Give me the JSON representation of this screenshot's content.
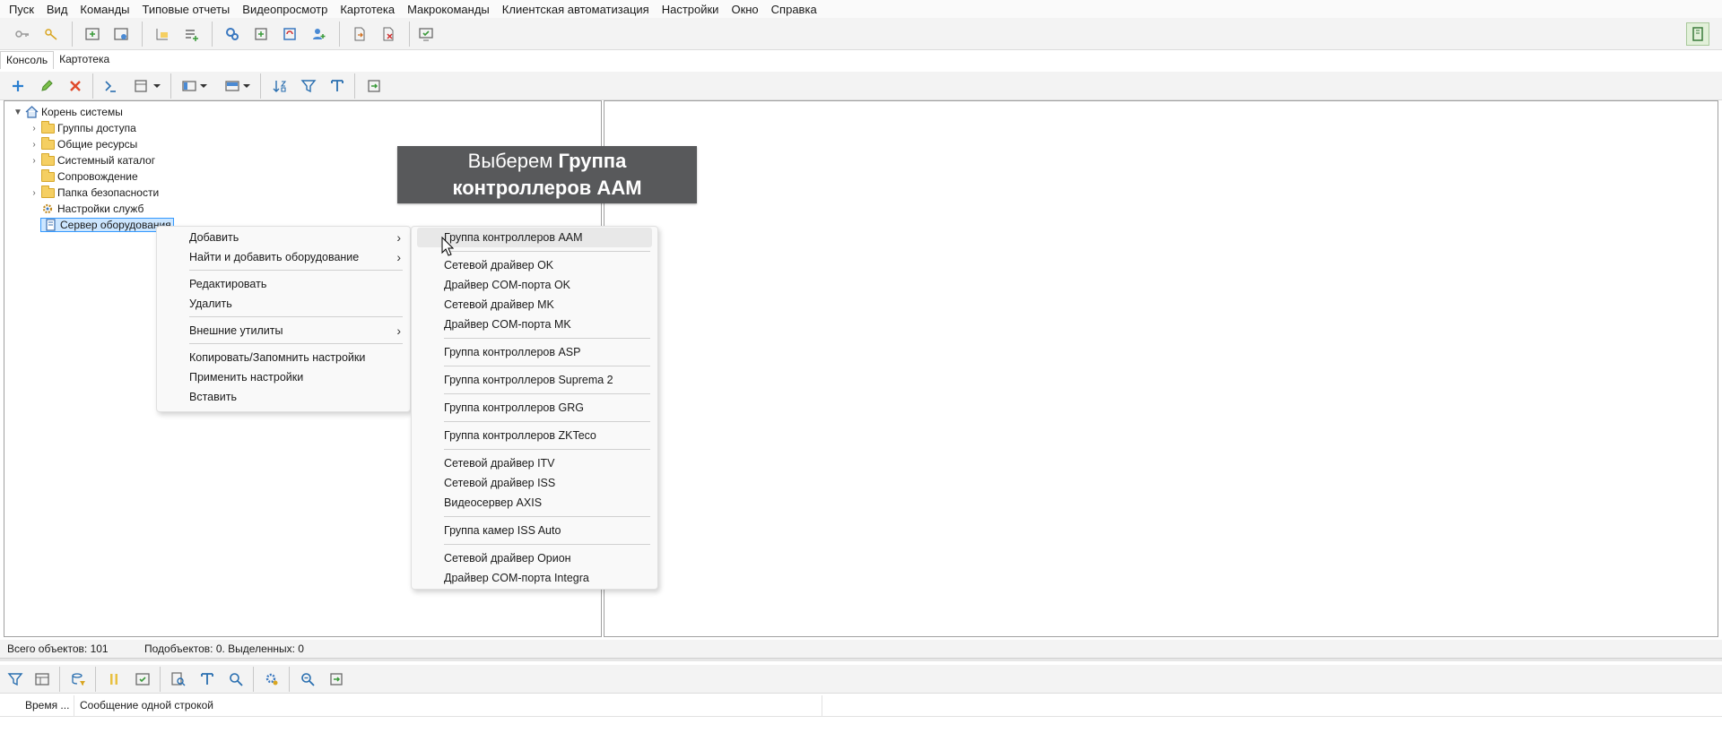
{
  "menubar": [
    "Пуск",
    "Вид",
    "Команды",
    "Типовые отчеты",
    "Видеопросмотр",
    "Картотека",
    "Макрокоманды",
    "Клиентская автоматизация",
    "Настройки",
    "Окно",
    "Справка"
  ],
  "tabs": {
    "console": "Консоль",
    "cardfile": "Картотека"
  },
  "tree": {
    "root": "Корень системы",
    "items": [
      "Группы доступа",
      "Общие ресурсы",
      "Системный каталог",
      "Сопровождение",
      "Папка безопасности",
      "Настройки служб",
      "Сервер оборудования"
    ]
  },
  "banner": {
    "normal": "Выберем ",
    "bold1": "Группа",
    "bold2": "контроллеров AAM"
  },
  "context_menu": {
    "add": "Добавить",
    "find_add": "Найти и добавить оборудование",
    "edit": "Редактировать",
    "delete": "Удалить",
    "external": "Внешние утилиты",
    "copy_settings": "Копировать/Запомнить настройки",
    "apply_settings": "Применить настройки",
    "paste": "Вставить"
  },
  "submenu": {
    "aam": "Группа контроллеров AAM",
    "net_ok": "Сетевой драйвер OK",
    "com_ok": "Драйвер COM-порта OK",
    "net_mk": "Сетевой драйвер MK",
    "com_mk": "Драйвер COM-порта MK",
    "asp": "Группа контроллеров ASP",
    "suprema": "Группа контроллеров Suprema 2",
    "grg": "Группа контроллеров GRG",
    "zkteco": "Группа контроллеров ZKTeco",
    "net_itv": "Сетевой драйвер ITV",
    "net_iss": "Сетевой драйвер ISS",
    "axis": "Видеосервер AXIS",
    "iss_auto": "Группа камер ISS Auto",
    "net_orion": "Сетевой драйвер Орион",
    "com_integra": "Драйвер COM-порта Integra"
  },
  "status": {
    "total": "Всего объектов: 101",
    "sub": "Подобъектов: 0. Выделенных: 0"
  },
  "log": {
    "time_col": "Время ...",
    "msg_col": "Сообщение одной строкой"
  },
  "colors": {
    "banner_bg": "#58595b",
    "selection": "#cce6ff",
    "folder": "#f5cf62"
  }
}
